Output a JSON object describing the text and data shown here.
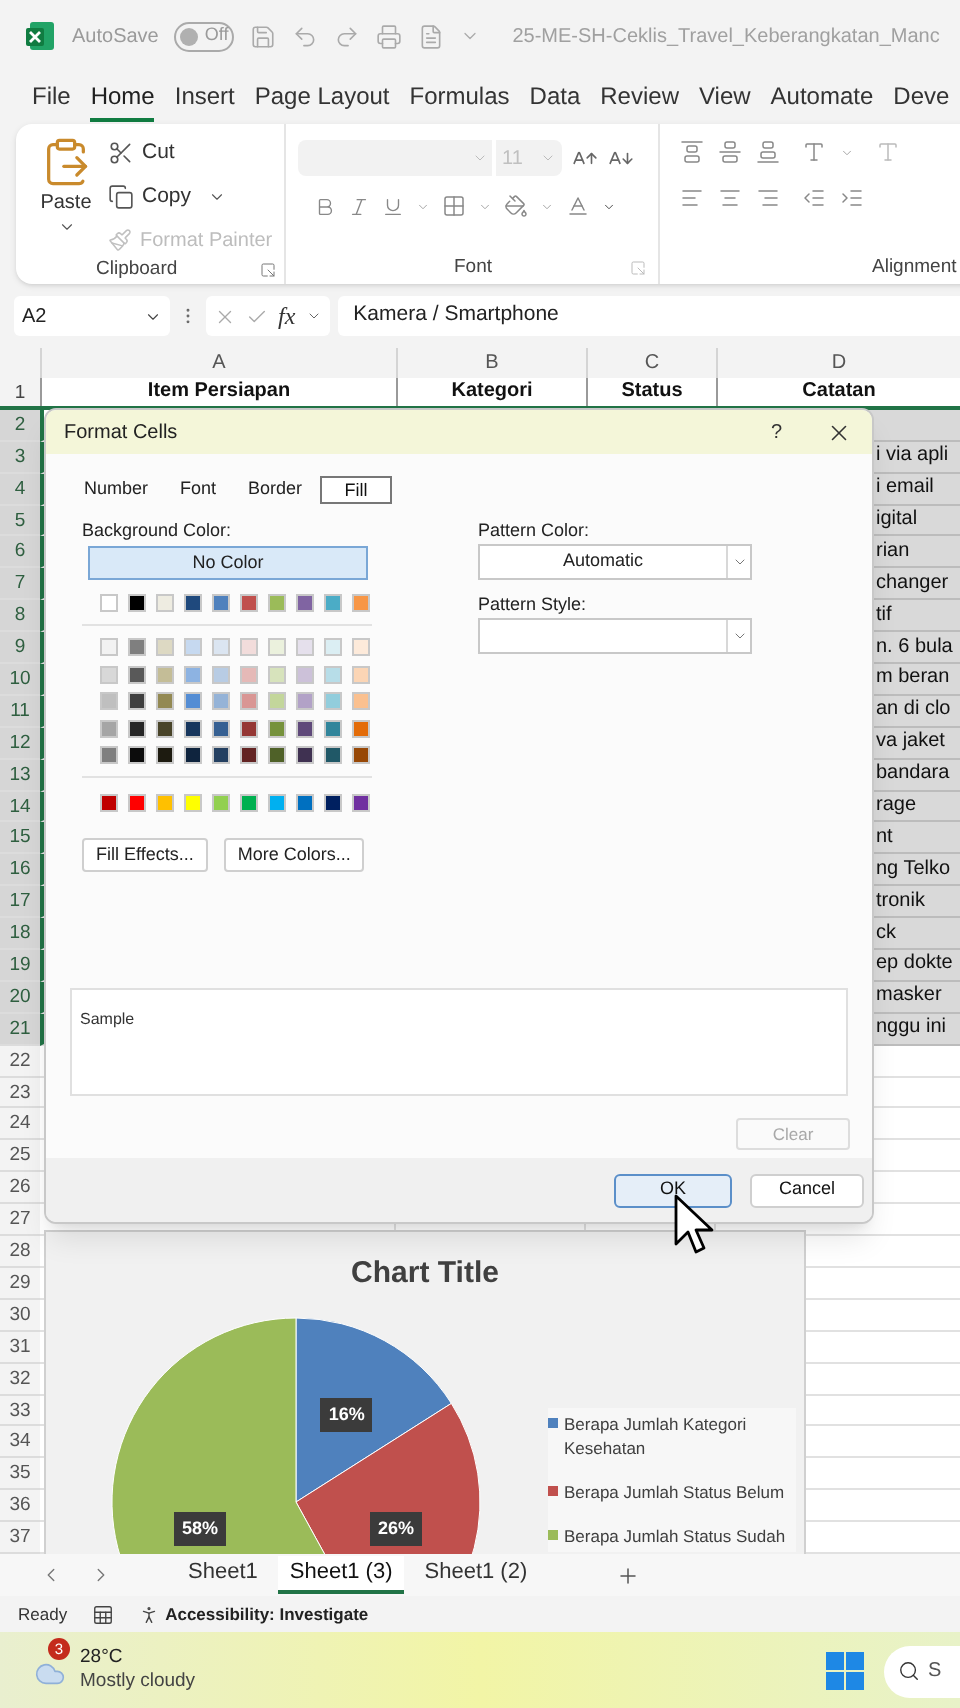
{
  "title_bar": {
    "autosave_label": "AutoSave",
    "autosave_toggle": {
      "on": false,
      "label": "Off"
    },
    "document_title": "25-ME-SH-Ceklis_Travel_Keberangkatan_Manc"
  },
  "menu_tabs": [
    {
      "label": "File",
      "selected": false
    },
    {
      "label": "Home",
      "selected": true
    },
    {
      "label": "Insert",
      "selected": false
    },
    {
      "label": "Page Layout",
      "selected": false
    },
    {
      "label": "Formulas",
      "selected": false
    },
    {
      "label": "Data",
      "selected": false
    },
    {
      "label": "Review",
      "selected": false
    },
    {
      "label": "View",
      "selected": false
    },
    {
      "label": "Automate",
      "selected": false
    },
    {
      "label": "Deve",
      "selected": false
    }
  ],
  "ribbon": {
    "clipboard": {
      "paste": "Paste",
      "cut": "Cut",
      "copy": "Copy",
      "format_painter": {
        "label": "Format Painter",
        "disabled": true
      },
      "group_label": "Clipboard"
    },
    "font": {
      "font_size": {
        "value": "11",
        "disabled": true
      },
      "group_label": "Font"
    },
    "alignment": {
      "group_label": "Alignment"
    }
  },
  "formula_bar": {
    "name_box": "A2",
    "fx": "fx",
    "value": "Kamera / Smartphone"
  },
  "sheet": {
    "columns": [
      "A",
      "B",
      "C",
      "D"
    ],
    "header_row": {
      "number": "1",
      "cells": [
        "Item Persiapan",
        "Kategori",
        "Status",
        "Catatan"
      ]
    },
    "rows": [
      {
        "number": "2",
        "selected": true
      },
      {
        "number": "3",
        "selected": true,
        "column_d": "i via apli"
      },
      {
        "number": "4",
        "selected": true,
        "column_d": "i email"
      },
      {
        "number": "5",
        "selected": true,
        "column_d": "igital"
      },
      {
        "number": "6",
        "selected": true,
        "column_d": "rian"
      },
      {
        "number": "7",
        "selected": true,
        "column_d": "changer"
      },
      {
        "number": "8",
        "selected": true,
        "column_d": "tif"
      },
      {
        "number": "9",
        "selected": true,
        "column_d": "n. 6 bula"
      },
      {
        "number": "10",
        "selected": true,
        "column_d": "m beran"
      },
      {
        "number": "11",
        "selected": true,
        "column_d": "an di clo"
      },
      {
        "number": "12",
        "selected": true,
        "column_d": "va jaket"
      },
      {
        "number": "13",
        "selected": true,
        "column_d": "bandara"
      },
      {
        "number": "14",
        "selected": true,
        "column_d": "rage"
      },
      {
        "number": "15",
        "selected": true,
        "column_d": "nt"
      },
      {
        "number": "16",
        "selected": true,
        "column_d": "ng Telko"
      },
      {
        "number": "17",
        "selected": true,
        "column_d": "tronik"
      },
      {
        "number": "18",
        "selected": true,
        "column_d": "ck"
      },
      {
        "number": "19",
        "selected": true,
        "column_d": "ep dokte"
      },
      {
        "number": "20",
        "selected": true,
        "column_d": "masker"
      },
      {
        "number": "21",
        "selected": true,
        "column_d": "nggu ini"
      },
      {
        "number": "22",
        "selected": false
      },
      {
        "number": "23",
        "selected": false
      },
      {
        "number": "24",
        "selected": false
      },
      {
        "number": "25",
        "selected": false
      },
      {
        "number": "26",
        "selected": false
      },
      {
        "number": "27",
        "selected": false
      },
      {
        "number": "28",
        "selected": false
      },
      {
        "number": "29",
        "selected": false
      },
      {
        "number": "30",
        "selected": false
      },
      {
        "number": "31",
        "selected": false
      },
      {
        "number": "32",
        "selected": false
      },
      {
        "number": "33",
        "selected": false
      },
      {
        "number": "34",
        "selected": false
      },
      {
        "number": "35",
        "selected": false
      },
      {
        "number": "36",
        "selected": false
      },
      {
        "number": "37",
        "selected": false
      }
    ],
    "chart": {
      "chart_data": {
        "type": "pie",
        "title": "Chart Title",
        "categories": [
          "Berapa Jumlah Kategori Kesehatan",
          "Berapa Jumlah Status Belum",
          "Berapa Jumlah Status Sudah"
        ],
        "values": [
          16,
          26,
          58
        ],
        "colors": [
          "#4f81bd",
          "#c0504d",
          "#9bbb59"
        ],
        "value_labels": [
          "16%",
          "26%",
          "58%"
        ],
        "legend": "right"
      }
    }
  },
  "dialog": {
    "title": "Format Cells",
    "help": "?",
    "tabs": [
      {
        "label": "Number",
        "selected": false
      },
      {
        "label": "Font",
        "selected": false
      },
      {
        "label": "Border",
        "selected": false
      },
      {
        "label": "Fill",
        "selected": true
      }
    ],
    "background_color_label": "Background Color:",
    "no_color": {
      "label": "No Color",
      "selected": true
    },
    "theme_colors": [
      {
        "color": "#ffffff"
      },
      {
        "color": "#000000"
      },
      {
        "color": "#eeece1"
      },
      {
        "color": "#1f497d"
      },
      {
        "color": "#4f81bd"
      },
      {
        "color": "#c0504d"
      },
      {
        "color": "#9bbb59"
      },
      {
        "color": "#8064a2"
      },
      {
        "color": "#4bacc6"
      },
      {
        "color": "#f79646"
      }
    ],
    "shade_rows": [
      [
        {
          "color": "#f2f2f2"
        },
        {
          "color": "#7f7f7f"
        },
        {
          "color": "#ddd9c3"
        },
        {
          "color": "#c6d9f0"
        },
        {
          "color": "#dbe5f1"
        },
        {
          "color": "#f2dcdb"
        },
        {
          "color": "#ebf1dd"
        },
        {
          "color": "#e5e0ec"
        },
        {
          "color": "#dbeef3"
        },
        {
          "color": "#fdeada"
        }
      ],
      [
        {
          "color": "#d8d8d8"
        },
        {
          "color": "#595959"
        },
        {
          "color": "#c4bd97"
        },
        {
          "color": "#8db3e2"
        },
        {
          "color": "#b8cce4"
        },
        {
          "color": "#e5b9b7"
        },
        {
          "color": "#d7e3bc"
        },
        {
          "color": "#ccc1d9"
        },
        {
          "color": "#b7dde8"
        },
        {
          "color": "#fbd5b5"
        }
      ],
      [
        {
          "color": "#bfbfbf"
        },
        {
          "color": "#3f3f3f"
        },
        {
          "color": "#938953"
        },
        {
          "color": "#548dd4"
        },
        {
          "color": "#95b3d7"
        },
        {
          "color": "#d99694"
        },
        {
          "color": "#c3d69b"
        },
        {
          "color": "#b2a2c7"
        },
        {
          "color": "#92cddc"
        },
        {
          "color": "#fac08f"
        }
      ],
      [
        {
          "color": "#a5a5a5"
        },
        {
          "color": "#262626"
        },
        {
          "color": "#494429"
        },
        {
          "color": "#17365d"
        },
        {
          "color": "#366092"
        },
        {
          "color": "#953734"
        },
        {
          "color": "#76923c"
        },
        {
          "color": "#5f497a"
        },
        {
          "color": "#31859b"
        },
        {
          "color": "#e36c09"
        }
      ],
      [
        {
          "color": "#7f7f7f"
        },
        {
          "color": "#0c0c0c"
        },
        {
          "color": "#1d1b10"
        },
        {
          "color": "#0f243e"
        },
        {
          "color": "#244061"
        },
        {
          "color": "#632423"
        },
        {
          "color": "#4f6128"
        },
        {
          "color": "#3f3151"
        },
        {
          "color": "#205867"
        },
        {
          "color": "#974806"
        }
      ]
    ],
    "standard_colors": [
      {
        "color": "#c00000"
      },
      {
        "color": "#ff0000"
      },
      {
        "color": "#ffc000"
      },
      {
        "color": "#ffff00"
      },
      {
        "color": "#92d050"
      },
      {
        "color": "#00b050"
      },
      {
        "color": "#00b0f0"
      },
      {
        "color": "#0070c0"
      },
      {
        "color": "#002060"
      },
      {
        "color": "#7030a0"
      }
    ],
    "fill_effects": "Fill Effects...",
    "more_colors": "More Colors...",
    "pattern_color_label": "Pattern Color:",
    "pattern_color": "Automatic",
    "pattern_style_label": "Pattern Style:",
    "sample_label": "Sample",
    "clear": {
      "label": "Clear",
      "disabled": true
    },
    "ok": "OK",
    "cancel": "Cancel"
  },
  "sheet_tabs": [
    {
      "label": "Sheet1",
      "selected": false
    },
    {
      "label": "Sheet1 (3)",
      "selected": true
    },
    {
      "label": "Sheet1 (2)",
      "selected": false
    }
  ],
  "status_bar": {
    "ready": "Ready",
    "accessibility": "Accessibility: Investigate"
  },
  "taskbar": {
    "weather": {
      "badge": "3",
      "temperature": "28°C",
      "condition": "Mostly cloudy"
    },
    "search": {
      "placeholder": "S"
    }
  }
}
